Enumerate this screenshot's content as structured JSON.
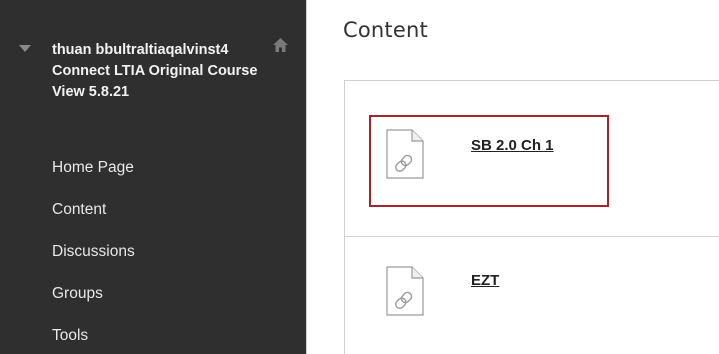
{
  "sidebar": {
    "course_title": "thuan bbultraltiaqalvinst4 Connect LTIA Original Course View 5.8.21",
    "items": [
      {
        "label": "Home Page"
      },
      {
        "label": "Content"
      },
      {
        "label": "Discussions"
      },
      {
        "label": "Groups"
      },
      {
        "label": "Tools"
      }
    ]
  },
  "main": {
    "title": "Content",
    "items": [
      {
        "label": "SB 2.0 Ch 1",
        "icon": "link-file-icon",
        "highlighted": true
      },
      {
        "label": "EZT",
        "icon": "link-file-icon",
        "highlighted": false
      }
    ]
  },
  "colors": {
    "sidebar_bg": "#2f2f2f",
    "highlight_border": "#a5242a"
  }
}
